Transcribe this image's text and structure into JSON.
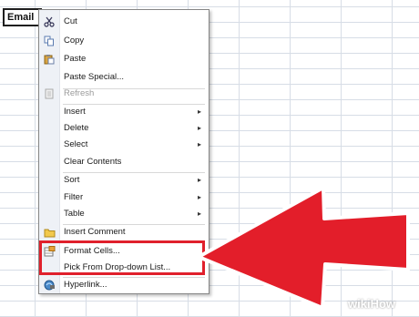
{
  "cell": {
    "value": "Email"
  },
  "menu": {
    "cut": "Cut",
    "copy": "Copy",
    "paste": "Paste",
    "paste_special": "Paste Special...",
    "refresh": "Refresh",
    "insert": "Insert",
    "delete": "Delete",
    "select": "Select",
    "clear_contents": "Clear Contents",
    "sort": "Sort",
    "filter": "Filter",
    "table": "Table",
    "insert_comment": "Insert Comment",
    "format_cells": "Format Cells...",
    "pick_from_dropdown": "Pick From Drop-down List...",
    "hyperlink": "Hyperlink..."
  },
  "submenu_arrow": "▸",
  "watermark": {
    "prefix": "wiki",
    "suffix": "How"
  },
  "colors": {
    "highlight": "#e0202c"
  }
}
